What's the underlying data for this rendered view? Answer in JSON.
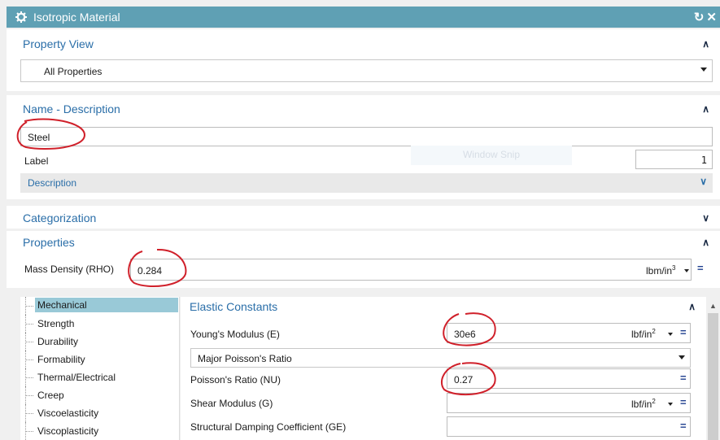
{
  "window": {
    "title": "Isotropic Material",
    "icons": [
      "gear-icon",
      "reset-icon",
      "close-icon"
    ]
  },
  "property_view": {
    "title": "Property View",
    "selected": "All Properties"
  },
  "name_description": {
    "title": "Name - Description",
    "name_value": "Steel",
    "label_text": "Label",
    "label_value": "1",
    "description_label": "Description",
    "watermark": "Window Snip"
  },
  "categorization": {
    "title": "Categorization"
  },
  "properties": {
    "title": "Properties",
    "mass_density_label": "Mass Density (RHO)",
    "mass_density_value": "0.284",
    "mass_density_unit": "lbm/in",
    "mass_density_unit_exp": "3"
  },
  "tree": {
    "items": [
      "Mechanical",
      "Strength",
      "Durability",
      "Formability",
      "Thermal/Electrical",
      "Creep",
      "Viscoelasticity",
      "Viscoplasticity"
    ],
    "selected": "Mechanical"
  },
  "elastic": {
    "title": "Elastic Constants",
    "youngs_label": "Young's Modulus (E)",
    "youngs_value": "30e6",
    "youngs_unit": "lbf/in",
    "youngs_unit_exp": "2",
    "poisson_type": "Major Poisson's Ratio",
    "poisson_label": "Poisson's Ratio (NU)",
    "poisson_value": "0.27",
    "shear_label": "Shear Modulus (G)",
    "shear_value": "",
    "shear_unit": "lbf/in",
    "shear_unit_exp": "2",
    "damping_label": "Structural Damping Coefficient (GE)",
    "damping_value": ""
  },
  "colors": {
    "titlebar": "#5fa0b4",
    "section_title": "#2a6ea8",
    "selection": "#99c9d7",
    "annotation": "#d0202a"
  }
}
